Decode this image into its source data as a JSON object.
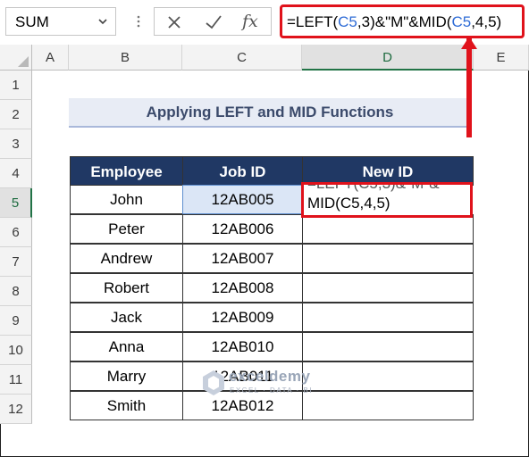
{
  "formula_bar": {
    "name_box": "SUM",
    "cancel_icon": "close-icon",
    "enter_icon": "check-icon",
    "function_icon_label": "fx",
    "formula_prefix": "=LEFT(",
    "ref1": "C5",
    "formula_mid": ",3)&\"M\"&MID(",
    "ref2": "C5",
    "formula_suffix": ",4,5)"
  },
  "columns": [
    "A",
    "B",
    "C",
    "D",
    "E"
  ],
  "rows": [
    "1",
    "2",
    "3",
    "4",
    "5",
    "6",
    "7",
    "8",
    "9",
    "10",
    "11",
    "12"
  ],
  "active_cell": "D5",
  "title": "Applying LEFT and MID Functions",
  "table": {
    "headers": [
      "Employee",
      "Job ID",
      "New ID"
    ],
    "rows": [
      {
        "employee": "John",
        "job_id": "12AB005",
        "new_id": "MID(C5,4,5)"
      },
      {
        "employee": "Peter",
        "job_id": "12AB006",
        "new_id": ""
      },
      {
        "employee": "Andrew",
        "job_id": "12AB007",
        "new_id": ""
      },
      {
        "employee": "Robert",
        "job_id": "12AB008",
        "new_id": ""
      },
      {
        "employee": "Jack",
        "job_id": "12AB009",
        "new_id": ""
      },
      {
        "employee": "Anna",
        "job_id": "12AB010",
        "new_id": ""
      },
      {
        "employee": "Marry",
        "job_id": "12AB011",
        "new_id": ""
      },
      {
        "employee": "Smith",
        "job_id": "12AB012",
        "new_id": ""
      }
    ]
  },
  "editing_cell_text": "MID(C5,4,5)",
  "editing_cell_overflow_text": "=LEFT(C5,3)&\"M\"&",
  "watermark": {
    "name": "exceldemy",
    "tagline": "EXCEL · DATA · BI"
  },
  "colors": {
    "header_fill": "#203864",
    "highlight": "#e0121b",
    "ref_blue": "#2f6cd6"
  }
}
